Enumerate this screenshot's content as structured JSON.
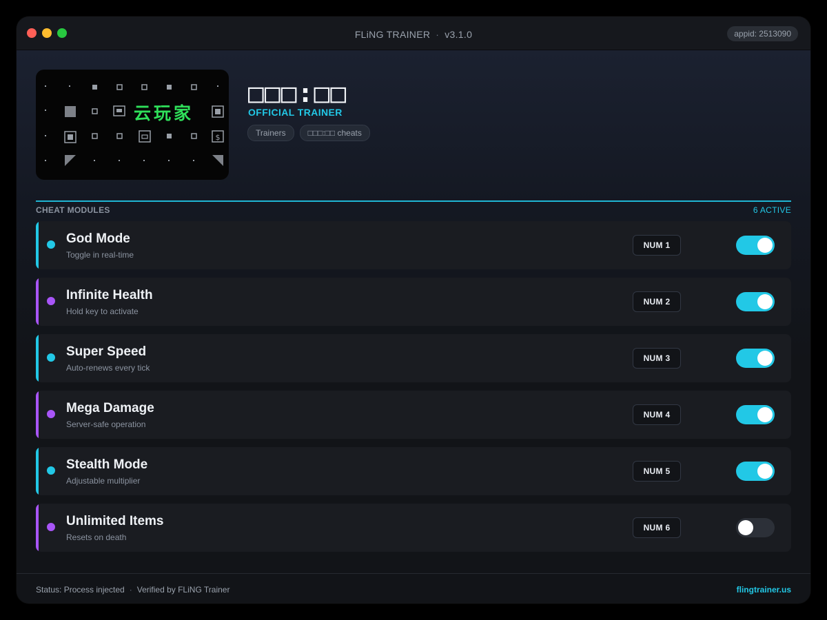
{
  "window": {
    "title_app": "FLiNG TRAINER",
    "title_separator": "·",
    "title_version": "v3.1.0",
    "appid": "appid: 2513090"
  },
  "header": {
    "cover_text": "云玩家",
    "timer": "□□□:□□",
    "subtitle": "OFFICIAL TRAINER",
    "chips": [
      "Trainers",
      "□□□:□□ cheats"
    ]
  },
  "section": {
    "title": "CHEAT MODULES",
    "count": "6 ACTIVE"
  },
  "colors": {
    "cyan": "#22c8e6",
    "purple": "#a855f7"
  },
  "cheats": [
    {
      "name": "God Mode",
      "desc": "Toggle in real-time",
      "key": "NUM 1",
      "enabled": true,
      "accent": "#22c8e6"
    },
    {
      "name": "Infinite Health",
      "desc": "Hold key to activate",
      "key": "NUM 2",
      "enabled": true,
      "accent": "#a855f7"
    },
    {
      "name": "Super Speed",
      "desc": "Auto-renews every tick",
      "key": "NUM 3",
      "enabled": true,
      "accent": "#22c8e6"
    },
    {
      "name": "Mega Damage",
      "desc": "Server-safe operation",
      "key": "NUM 4",
      "enabled": true,
      "accent": "#a855f7"
    },
    {
      "name": "Stealth Mode",
      "desc": "Adjustable multiplier",
      "key": "NUM 5",
      "enabled": true,
      "accent": "#22c8e6"
    },
    {
      "name": "Unlimited Items",
      "desc": "Resets on death",
      "key": "NUM 6",
      "enabled": false,
      "accent": "#a855f7"
    }
  ],
  "footer": {
    "status": "Status: Process injected",
    "separator": "·",
    "verified": "Verified by FLiNG Trainer",
    "site": "flingtrainer.us"
  }
}
